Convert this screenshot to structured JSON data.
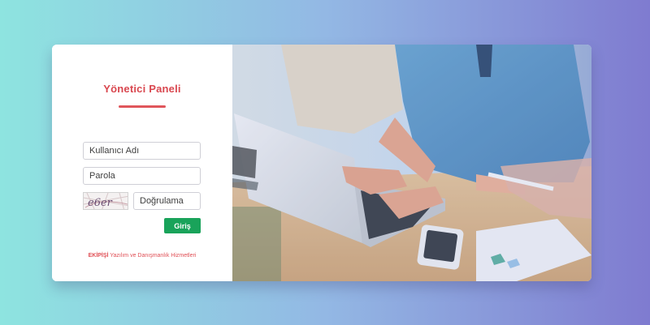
{
  "panel": {
    "title": "Yönetici Paneli"
  },
  "form": {
    "username_placeholder": "Kullanıcı Adı",
    "password_placeholder": "Parola",
    "captcha_text": "e6er",
    "verification_placeholder": "Doğrulama",
    "submit_label": "Giriş"
  },
  "footer": {
    "brand": "EKİPİŞİ",
    "text": " Yazılım ve Danışmanlık Hizmetleri"
  },
  "colors": {
    "accent": "#d9474f",
    "button": "#19a35a"
  }
}
